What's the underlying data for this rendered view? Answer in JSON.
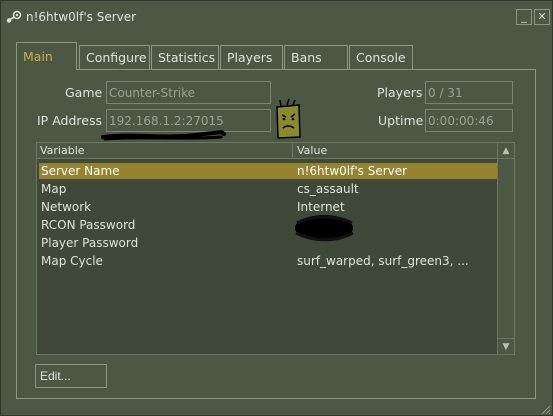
{
  "window": {
    "title": "n!6htw0lf's Server",
    "minimize_icon": "minimize-icon",
    "close_icon": "close-icon",
    "minimize_glyph": "_",
    "close_glyph": "✕"
  },
  "tabs": [
    {
      "label": "Main",
      "active": true
    },
    {
      "label": "Configure",
      "active": false
    },
    {
      "label": "Statistics",
      "active": false
    },
    {
      "label": "Players",
      "active": false
    },
    {
      "label": "Bans",
      "active": false
    },
    {
      "label": "Console",
      "active": false
    }
  ],
  "info": {
    "game_label": "Game",
    "game_value": "Counter-Strike",
    "ip_label": "IP Address",
    "ip_value": "192.168.1.2:27015",
    "players_label": "Players",
    "players_value": "0 / 31",
    "uptime_label": "Uptime",
    "uptime_value": "0:00:00:46"
  },
  "list": {
    "columns": [
      "Variable",
      "Value"
    ],
    "rows": [
      {
        "variable": "Server Name",
        "value": "n!6htw0lf's Server",
        "selected": true
      },
      {
        "variable": "Map",
        "value": "cs_assault",
        "selected": false
      },
      {
        "variable": "Network",
        "value": "Internet",
        "selected": false
      },
      {
        "variable": "RCON Password",
        "value": "",
        "selected": false
      },
      {
        "variable": "Player Password",
        "value": "",
        "selected": false
      },
      {
        "variable": "Map Cycle",
        "value": "surf_warped, surf_green3, ...",
        "selected": false
      }
    ],
    "scroll_up_glyph": "▲",
    "scroll_down_glyph": "▼"
  },
  "buttons": {
    "edit": "Edit..."
  },
  "colors": {
    "background": "#4c5844",
    "list_background": "#3f4839",
    "selection": "#958330",
    "active_tab_text": "#c9b046"
  }
}
